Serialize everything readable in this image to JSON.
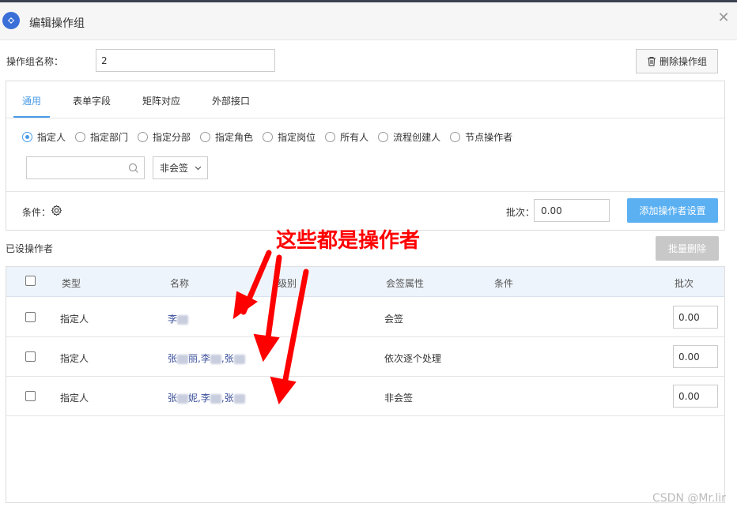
{
  "dialog": {
    "title": "编辑操作组",
    "close_icon": "close-icon",
    "logo_icon": "app-logo-icon"
  },
  "group": {
    "name_label": "操作组名称：",
    "name_value": "2",
    "delete_button": "删除操作组"
  },
  "tabs": [
    {
      "label": "通用",
      "active": true
    },
    {
      "label": "表单字段",
      "active": false
    },
    {
      "label": "矩阵对应",
      "active": false
    },
    {
      "label": "外部接口",
      "active": false
    }
  ],
  "radio_options": [
    {
      "label": "指定人",
      "checked": true
    },
    {
      "label": "指定部门",
      "checked": false
    },
    {
      "label": "指定分部",
      "checked": false
    },
    {
      "label": "指定角色",
      "checked": false
    },
    {
      "label": "指定岗位",
      "checked": false
    },
    {
      "label": "所有人",
      "checked": false
    },
    {
      "label": "流程创建人",
      "checked": false
    },
    {
      "label": "节点操作者",
      "checked": false
    }
  ],
  "search": {
    "value": "",
    "placeholder": ""
  },
  "sign_select": {
    "selected": "非会签"
  },
  "condition": {
    "label": "条件：",
    "batch_label": "批次：",
    "batch_value": "0.00",
    "add_button": "添加操作者设置"
  },
  "operators": {
    "section_label": "已设操作者",
    "bulk_delete_button": "批量删除",
    "columns": [
      "类型",
      "名称",
      "级别",
      "会签属性",
      "条件",
      "批次"
    ],
    "rows": [
      {
        "type": "指定人",
        "name_parts": [
          "李"
        ],
        "level": "",
        "sign": "会签",
        "condition": "",
        "batch": "0.00"
      },
      {
        "type": "指定人",
        "name_parts": [
          "张",
          "丽,李",
          ",张"
        ],
        "level": "",
        "sign": "依次逐个处理",
        "condition": "",
        "batch": "0.00"
      },
      {
        "type": "指定人",
        "name_parts": [
          "张",
          "妮,李",
          ",张"
        ],
        "level": "",
        "sign": "非会签",
        "condition": "",
        "batch": "0.00"
      }
    ]
  },
  "annotation": {
    "text": "这些都是操作者",
    "color": "#ff0000"
  },
  "watermark": "CSDN @Mr.lir",
  "colors": {
    "accent": "#4a9be8",
    "primary_button": "#5bb0f2",
    "disabled_button": "#c8c8c8",
    "table_header": "#eef4fb"
  }
}
